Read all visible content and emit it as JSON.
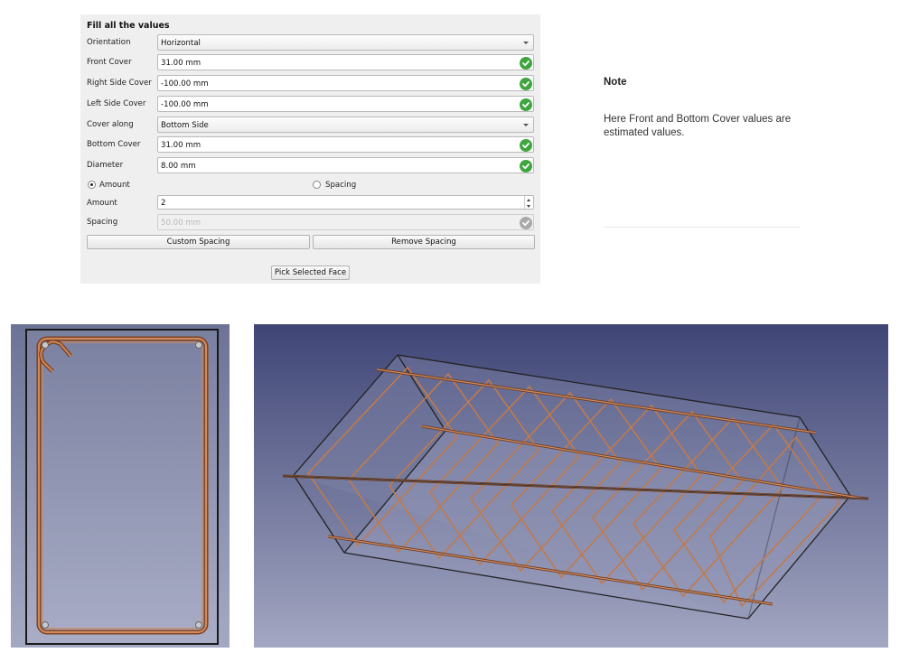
{
  "form": {
    "title": "Fill all the values",
    "fields": {
      "orientation": {
        "label": "Orientation",
        "value": "Horizontal"
      },
      "front_cover": {
        "label": "Front Cover",
        "value": "31.00 mm"
      },
      "right_side_cover": {
        "label": "Right Side Cover",
        "value": "-100.00 mm"
      },
      "left_side_cover": {
        "label": "Left Side Cover",
        "value": "-100.00 mm"
      },
      "cover_along": {
        "label": "Cover along",
        "value": "Bottom Side"
      },
      "bottom_cover": {
        "label": "Bottom Cover",
        "value": "31.00 mm"
      },
      "diameter": {
        "label": "Diameter",
        "value": "8.00 mm"
      },
      "amount": {
        "label": "Amount",
        "value": "2"
      },
      "spacing": {
        "label": "Spacing",
        "value": "50.00 mm"
      }
    },
    "mode": {
      "amount_label": "Amount",
      "spacing_label": "Spacing",
      "selected": "Amount"
    },
    "buttons": {
      "custom_spacing": "Custom Spacing",
      "remove_spacing": "Remove Spacing",
      "pick_selected_face": "Pick Selected Face"
    }
  },
  "note": {
    "title": "Note",
    "text": "Here Front and Bottom Cover values are estimated values."
  },
  "icons": {
    "valid": "check-circle-icon",
    "dropdown": "chevron-down-icon",
    "spinner": "spinner-arrows-icon"
  },
  "colors": {
    "panel_bg": "#efefef",
    "valid_green": "#3fa63f",
    "rebar": "#b5663a",
    "viewport_top": "#3f4576",
    "viewport_bottom": "#a3a7c2",
    "section_top": "#6c7396",
    "section_bottom": "#a4a9c3"
  }
}
